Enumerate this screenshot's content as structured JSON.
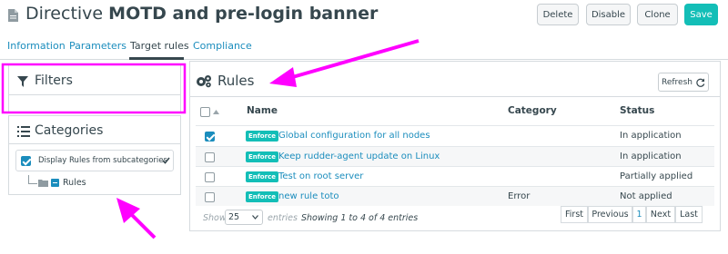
{
  "header": {
    "title_prefix": "Directive",
    "title_bold": "MOTD and pre-login banner",
    "buttons": {
      "delete": "Delete",
      "disable": "Disable",
      "clone": "Clone",
      "save": "Save"
    }
  },
  "tabs": [
    "Information",
    "Parameters",
    "Target rules",
    "Compliance"
  ],
  "active_tab": "Target rules",
  "filters": {
    "title": "Filters"
  },
  "categories": {
    "title": "Categories",
    "subcategories_label": "Display Rules from subcategories",
    "tree_root": "Rules"
  },
  "rules": {
    "title": "Rules",
    "refresh_label": "Refresh",
    "columns": {
      "name": "Name",
      "category": "Category",
      "status": "Status"
    },
    "rows": [
      {
        "checked": true,
        "badge": "Enforce",
        "name": "Global configuration for all nodes",
        "category": "",
        "status": "In application"
      },
      {
        "checked": false,
        "badge": "Enforce",
        "name": "Keep rudder-agent update on Linux",
        "category": "",
        "status": "In application"
      },
      {
        "checked": false,
        "badge": "Enforce",
        "name": "Test on root server",
        "category": "",
        "status": "Partially applied"
      },
      {
        "checked": false,
        "badge": "Enforce",
        "name": "new rule toto",
        "category": "Error",
        "status": "Not applied"
      }
    ],
    "footer": {
      "show_label": "Show",
      "page_size": "25",
      "entries_label": "entries",
      "info": "Showing 1 to 4 of 4 entries",
      "pager": {
        "first": "First",
        "previous": "Previous",
        "current": "1",
        "next": "Next",
        "last": "Last"
      }
    }
  },
  "colors": {
    "accent": "#13beb7",
    "link": "#1b8dbd",
    "annotation": "#ff00ff"
  },
  "icons": [
    "document-icon",
    "filter-icon",
    "list-icon",
    "gears-icon",
    "refresh-icon",
    "folder-icon",
    "checkbox-icon",
    "sort-up-icon",
    "chevron-down-icon"
  ]
}
